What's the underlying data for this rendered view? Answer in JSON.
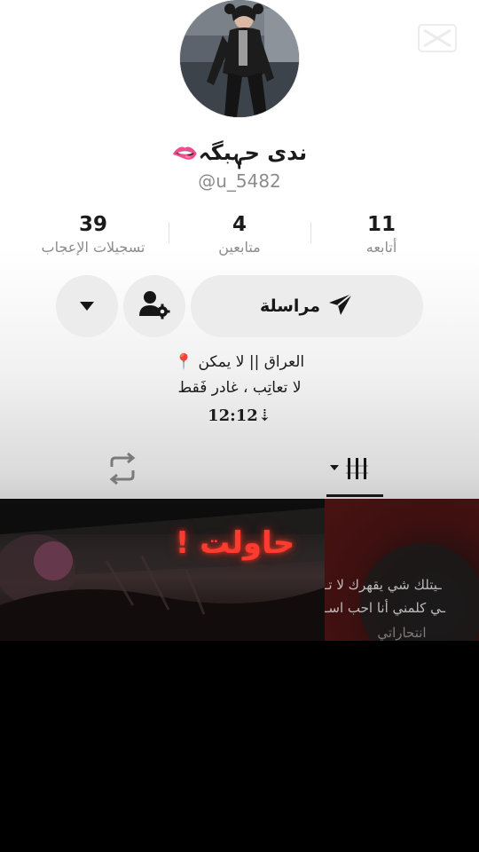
{
  "profile": {
    "display_name": "ندى حہٖبگہ",
    "name_emoji": "🫦",
    "username": "@u_5482"
  },
  "stats": {
    "likes": {
      "value": "39",
      "label": "تسجيلات الإعجاب"
    },
    "followers": {
      "value": "4",
      "label": "متابعين"
    },
    "following": {
      "value": "11",
      "label": "أتابعه"
    }
  },
  "actions": {
    "message_label": "مراسلة"
  },
  "bio": {
    "line1": "العراق || لا يمكن 📍",
    "line2": "لا تعاتِب ، غادر فَقط",
    "line3": "12:12⇣"
  },
  "videos": {
    "thumb1_text": "حاولت !",
    "thumb2_lines": [
      "ـيتلك شي يقهرك لا تـ",
      "ـي كلمني أنا احب اسـ",
      "انتحاراتي"
    ]
  },
  "colors": {
    "accent_red": "#ff3b2f",
    "button_bg": "#ececec",
    "muted_text": "#8c8c8c"
  },
  "icons": {
    "send": "paper-plane-icon",
    "add_user": "user-settings-icon",
    "dropdown": "caret-down-icon",
    "repost": "repost-icon",
    "grid": "grid-icon"
  }
}
